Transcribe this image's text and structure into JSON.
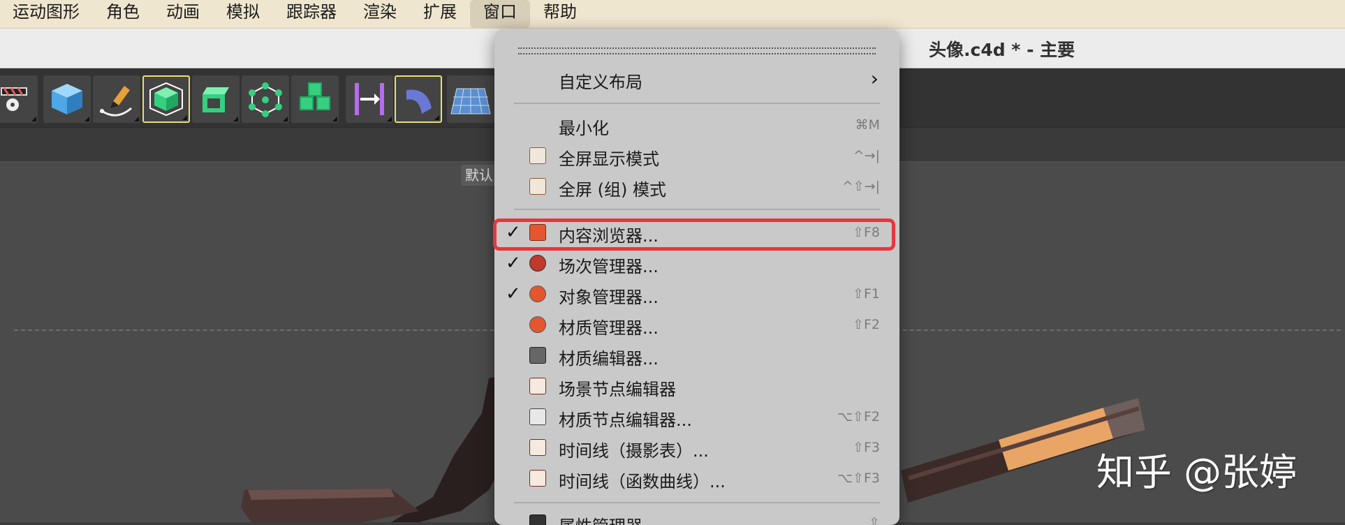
{
  "menubar": {
    "items": [
      "运动图形",
      "角色",
      "动画",
      "模拟",
      "跟踪器",
      "渲染",
      "扩展",
      "窗口",
      "帮助"
    ],
    "active_index": 7
  },
  "window": {
    "title": "头像.c4d * - 主要"
  },
  "toolbar": {
    "buttons": [
      {
        "icon": "clapper-gear-icon"
      },
      {
        "icon": "cube-icon"
      },
      {
        "icon": "pen-spline-icon"
      },
      {
        "icon": "subdivision-cube-icon"
      },
      {
        "icon": "extrude-box-icon"
      },
      {
        "icon": "mograph-cloner-icon"
      },
      {
        "icon": "cubes-array-icon"
      },
      {
        "icon": "deformer-bend-icon"
      },
      {
        "icon": "camera-tool-icon"
      },
      {
        "icon": "floor-grid-icon"
      }
    ]
  },
  "viewport": {
    "default_label": "默认"
  },
  "window_menu": {
    "items": [
      {
        "label": "自定义布局",
        "shortcut": "",
        "submenu": true,
        "checked": false,
        "icon": ""
      },
      {
        "label": "最小化",
        "shortcut": "⌘M",
        "checked": false,
        "icon": ""
      },
      {
        "label": "全屏显示模式",
        "shortcut": "^→|",
        "checked": false,
        "icon": "fullscreen-icon"
      },
      {
        "label": "全屏 (组) 模式",
        "shortcut": "^⇧→|",
        "checked": false,
        "icon": "fullscreen-group-icon"
      },
      {
        "label": "内容浏览器...",
        "shortcut": "⇧F8",
        "checked": true,
        "icon": "content-browser-icon"
      },
      {
        "label": "场次管理器...",
        "shortcut": "",
        "checked": true,
        "icon": "take-manager-icon"
      },
      {
        "label": "对象管理器...",
        "shortcut": "⇧F1",
        "checked": true,
        "icon": "object-manager-icon"
      },
      {
        "label": "材质管理器...",
        "shortcut": "⇧F2",
        "checked": false,
        "icon": "material-manager-icon"
      },
      {
        "label": "材质编辑器...",
        "shortcut": "",
        "checked": false,
        "icon": "material-editor-icon"
      },
      {
        "label": "场景节点编辑器",
        "shortcut": "",
        "checked": false,
        "icon": "scene-nodes-icon"
      },
      {
        "label": "材质节点编辑器...",
        "shortcut": "⌥⇧F2",
        "checked": false,
        "icon": "material-nodes-icon"
      },
      {
        "label": "时间线（摄影表）...",
        "shortcut": "⇧F3",
        "checked": false,
        "icon": "timeline-dopesheet-icon"
      },
      {
        "label": "时间线（函数曲线）...",
        "shortcut": "⌥⇧F3",
        "checked": false,
        "icon": "timeline-fcurve-icon"
      },
      {
        "label": "属性管理器...",
        "shortcut": "⇧",
        "checked": false,
        "icon": "attribute-manager-icon"
      }
    ],
    "checkmark": "✓",
    "submenu_arrow": "›"
  },
  "watermark": {
    "text": "知乎 @张婷"
  },
  "colors": {
    "highlight": "#e8363c",
    "icon_orange": "#e4572e",
    "tool_green": "#35d07f",
    "tool_blue": "#4ea8e6"
  }
}
